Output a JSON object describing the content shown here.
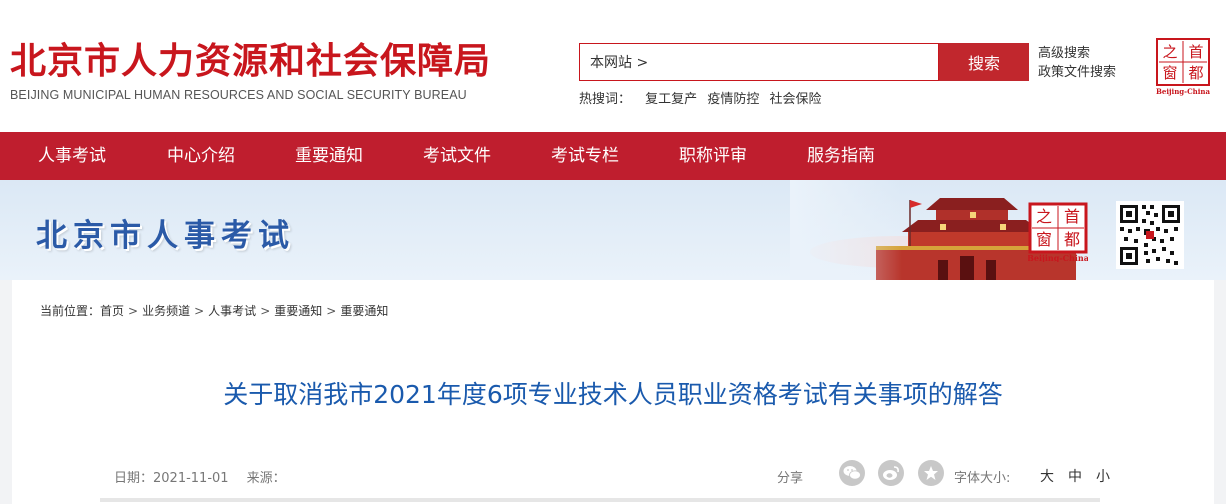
{
  "header": {
    "title": "北京市人力资源和社会保障局",
    "subtitle": "BEIJING MUNICIPAL HUMAN RESOURCES AND SOCIAL SECURITY BUREAU",
    "search": {
      "value": "本网站 >",
      "button": "搜索"
    },
    "advanced_search": "高级搜索",
    "policy_search": "政策文件搜索",
    "hot_label": "热搜词：",
    "hot_words": [
      "复工复产",
      "疫情防控",
      "社会保险"
    ],
    "logo": {
      "top_left": "之",
      "top_right": "首",
      "bottom_left": "窗",
      "bottom_right": "都",
      "caption": "Beijing-China"
    }
  },
  "nav": {
    "items": [
      "人事考试",
      "中心介绍",
      "重要通知",
      "考试文件",
      "考试专栏",
      "职称评审",
      "服务指南"
    ]
  },
  "banner": {
    "title": "北京市人事考试"
  },
  "breadcrumb": {
    "label": "当前位置：",
    "items": [
      "首页",
      "业务频道",
      "人事考试",
      "重要通知",
      "重要通知"
    ],
    "separator": ">"
  },
  "article": {
    "title": "关于取消我市2021年度6项专业技术人员职业资格考试有关事项的解答",
    "date_label": "日期：",
    "date": "2021-11-01",
    "source_label": "来源：",
    "share_label": "分享",
    "font_size_label": "字体大小:",
    "font_sizes": [
      "大",
      "中",
      "小"
    ]
  },
  "colors": {
    "brand_red": "#c8161d",
    "nav_red": "#bf1e2e",
    "title_blue": "#1a5aad"
  }
}
